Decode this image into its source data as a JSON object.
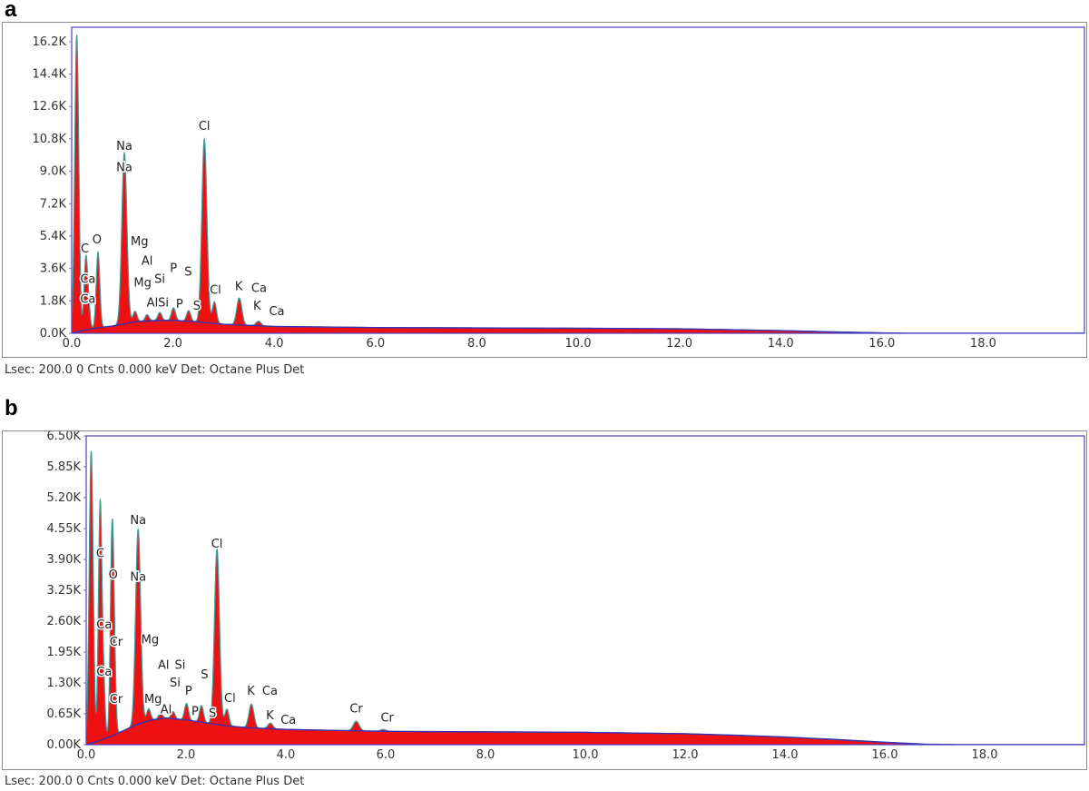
{
  "panels": [
    {
      "letter": "a",
      "status": "Lsec: 200.0 0 Cnts  0.000 keV Det: Octane Plus Det"
    },
    {
      "letter": "b",
      "status": "Lsec: 200.0 0 Cnts  0.000 keV Det: Octane Plus Det"
    }
  ],
  "chart_data": [
    {
      "type": "area",
      "panel": "a",
      "title": "",
      "xlabel": "",
      "ylabel": "",
      "xlim": [
        0.0,
        20.0
      ],
      "ylim": [
        0,
        17000
      ],
      "x_ticks": [
        0.0,
        2.0,
        4.0,
        6.0,
        8.0,
        10.0,
        12.0,
        14.0,
        16.0,
        18.0
      ],
      "x_tick_labels": [
        "0.0",
        "2.0",
        "4.0",
        "6.0",
        "8.0",
        "10.0",
        "12.0",
        "14.0",
        "16.0",
        "18.0"
      ],
      "y_ticks": [
        0,
        1800,
        3600,
        5400,
        7200,
        9000,
        10800,
        12600,
        14400,
        16200
      ],
      "y_tick_labels": [
        "0.0K",
        "1.8K",
        "3.6K",
        "5.4K",
        "7.2K",
        "9.0K",
        "10.8K",
        "12.6K",
        "14.4K",
        "16.2K"
      ],
      "background": {
        "x": [
          0.0,
          0.2,
          0.5,
          0.8,
          1.0,
          1.3,
          1.6,
          2.0,
          2.4,
          3.0,
          4.0,
          6.0,
          8.0,
          10.0,
          12.0,
          14.0,
          15.0,
          16.0,
          16.5,
          20.0
        ],
        "y": [
          0,
          150,
          300,
          400,
          500,
          650,
          700,
          720,
          650,
          500,
          380,
          320,
          300,
          280,
          250,
          150,
          80,
          20,
          0,
          0
        ]
      },
      "peaks": [
        {
          "x": 0.1,
          "y": 16500,
          "w": 0.04
        },
        {
          "x": 0.28,
          "y": 4000,
          "w": 0.035
        },
        {
          "x": 0.34,
          "y": 900,
          "w": 0.03
        },
        {
          "x": 0.52,
          "y": 4200,
          "w": 0.035
        },
        {
          "x": 1.04,
          "y": 9500,
          "w": 0.05
        },
        {
          "x": 1.25,
          "y": 600,
          "w": 0.04
        },
        {
          "x": 1.49,
          "y": 350,
          "w": 0.04
        },
        {
          "x": 1.74,
          "y": 450,
          "w": 0.04
        },
        {
          "x": 2.01,
          "y": 700,
          "w": 0.04
        },
        {
          "x": 2.31,
          "y": 600,
          "w": 0.04
        },
        {
          "x": 2.62,
          "y": 10200,
          "w": 0.05
        },
        {
          "x": 2.82,
          "y": 1200,
          "w": 0.04
        },
        {
          "x": 3.31,
          "y": 1500,
          "w": 0.05
        },
        {
          "x": 3.69,
          "y": 250,
          "w": 0.05
        }
      ],
      "labels": [
        {
          "text": "C",
          "x": 0.26,
          "y": 4500
        },
        {
          "text": "O",
          "x": 0.5,
          "y": 5000
        },
        {
          "text": "Ca",
          "x": 0.32,
          "y": 2800
        },
        {
          "text": "Ca",
          "x": 0.32,
          "y": 1700
        },
        {
          "text": "Na",
          "x": 1.04,
          "y": 10200
        },
        {
          "text": "Na",
          "x": 1.04,
          "y": 9000
        },
        {
          "text": "Mg",
          "x": 1.34,
          "y": 4900
        },
        {
          "text": "Al",
          "x": 1.49,
          "y": 3800
        },
        {
          "text": "Si",
          "x": 1.74,
          "y": 2800
        },
        {
          "text": "P",
          "x": 2.01,
          "y": 3400
        },
        {
          "text": "S",
          "x": 2.3,
          "y": 3200
        },
        {
          "text": "Mg",
          "x": 1.4,
          "y": 2600
        },
        {
          "text": "AlSi",
          "x": 1.7,
          "y": 1500
        },
        {
          "text": "P",
          "x": 2.13,
          "y": 1400
        },
        {
          "text": "S",
          "x": 2.47,
          "y": 1300
        },
        {
          "text": "Cl",
          "x": 2.62,
          "y": 11300
        },
        {
          "text": "Cl",
          "x": 2.84,
          "y": 2200
        },
        {
          "text": "K",
          "x": 3.3,
          "y": 2400
        },
        {
          "text": "Ca",
          "x": 3.7,
          "y": 2300
        },
        {
          "text": "K",
          "x": 3.66,
          "y": 1300
        },
        {
          "text": "Ca",
          "x": 4.05,
          "y": 1000
        }
      ]
    },
    {
      "type": "area",
      "panel": "b",
      "title": "",
      "xlabel": "",
      "ylabel": "",
      "xlim": [
        0.0,
        20.0
      ],
      "ylim": [
        0,
        6500
      ],
      "x_ticks": [
        0.0,
        2.0,
        4.0,
        6.0,
        8.0,
        10.0,
        12.0,
        14.0,
        16.0,
        18.0
      ],
      "x_tick_labels": [
        "0.0",
        "2.0",
        "4.0",
        "6.0",
        "8.0",
        "10.0",
        "12.0",
        "14.0",
        "16.0",
        "18.0"
      ],
      "y_ticks": [
        0,
        650,
        1300,
        1950,
        2600,
        3250,
        3900,
        4550,
        5200,
        5850,
        6500
      ],
      "y_tick_labels": [
        "0.00K",
        "0.65K",
        "1.30K",
        "1.95K",
        "2.60K",
        "3.25K",
        "3.90K",
        "4.55K",
        "5.20K",
        "5.85K",
        "6.50K"
      ],
      "background": {
        "x": [
          0.0,
          0.2,
          0.5,
          0.8,
          1.0,
          1.3,
          1.6,
          2.0,
          2.4,
          2.8,
          3.2,
          4.0,
          6.0,
          8.0,
          10.0,
          12.0,
          13.0,
          14.0,
          15.0,
          16.0,
          16.8,
          17.5,
          20.0
        ],
        "y": [
          0,
          60,
          180,
          320,
          420,
          520,
          560,
          520,
          460,
          400,
          360,
          320,
          280,
          270,
          260,
          230,
          200,
          160,
          110,
          50,
          10,
          0,
          0
        ]
      },
      "peaks": [
        {
          "x": 0.1,
          "y": 6150,
          "w": 0.04
        },
        {
          "x": 0.28,
          "y": 5000,
          "w": 0.035
        },
        {
          "x": 0.35,
          "y": 1000,
          "w": 0.03
        },
        {
          "x": 0.52,
          "y": 4350,
          "w": 0.035
        },
        {
          "x": 0.57,
          "y": 800,
          "w": 0.03
        },
        {
          "x": 1.04,
          "y": 4100,
          "w": 0.05
        },
        {
          "x": 1.25,
          "y": 250,
          "w": 0.04
        },
        {
          "x": 1.49,
          "y": 120,
          "w": 0.04
        },
        {
          "x": 1.74,
          "y": 150,
          "w": 0.04
        },
        {
          "x": 2.01,
          "y": 350,
          "w": 0.04
        },
        {
          "x": 2.31,
          "y": 350,
          "w": 0.04
        },
        {
          "x": 2.62,
          "y": 3700,
          "w": 0.05
        },
        {
          "x": 2.82,
          "y": 350,
          "w": 0.04
        },
        {
          "x": 3.31,
          "y": 500,
          "w": 0.05
        },
        {
          "x": 3.69,
          "y": 120,
          "w": 0.05
        },
        {
          "x": 5.41,
          "y": 200,
          "w": 0.06
        },
        {
          "x": 5.95,
          "y": 40,
          "w": 0.06
        }
      ],
      "labels": [
        {
          "text": "C",
          "x": 0.28,
          "y": 3950
        },
        {
          "text": "O",
          "x": 0.54,
          "y": 3500
        },
        {
          "text": "Ca",
          "x": 0.36,
          "y": 2450
        },
        {
          "text": "Cr",
          "x": 0.6,
          "y": 2080
        },
        {
          "text": "Ca",
          "x": 0.36,
          "y": 1450
        },
        {
          "text": "Cr",
          "x": 0.6,
          "y": 880
        },
        {
          "text": "Na",
          "x": 1.04,
          "y": 4650
        },
        {
          "text": "Na",
          "x": 1.04,
          "y": 3450
        },
        {
          "text": "Mg",
          "x": 1.28,
          "y": 2130
        },
        {
          "text": "Al",
          "x": 1.55,
          "y": 1600
        },
        {
          "text": "Si",
          "x": 1.88,
          "y": 1600
        },
        {
          "text": "Si",
          "x": 1.78,
          "y": 1220
        },
        {
          "text": "P",
          "x": 2.05,
          "y": 1050
        },
        {
          "text": "S",
          "x": 2.37,
          "y": 1400
        },
        {
          "text": "Mg",
          "x": 1.34,
          "y": 880
        },
        {
          "text": "Al",
          "x": 1.6,
          "y": 660
        },
        {
          "text": "P",
          "x": 2.18,
          "y": 620
        },
        {
          "text": "S",
          "x": 2.53,
          "y": 580
        },
        {
          "text": "Cl",
          "x": 2.62,
          "y": 4150
        },
        {
          "text": "Cl",
          "x": 2.88,
          "y": 900
        },
        {
          "text": "K",
          "x": 3.3,
          "y": 1050
        },
        {
          "text": "Ca",
          "x": 3.68,
          "y": 1050
        },
        {
          "text": "K",
          "x": 3.68,
          "y": 540
        },
        {
          "text": "Ca",
          "x": 4.05,
          "y": 440
        },
        {
          "text": "Cr",
          "x": 5.41,
          "y": 680
        },
        {
          "text": "Cr",
          "x": 6.03,
          "y": 490
        }
      ]
    }
  ],
  "colors": {
    "fill": "#ee1111",
    "trace": "#3f9a9c",
    "background_line": "#3b30b0",
    "plot_border": "#4a3fc2",
    "label_shadow": "#ffffff"
  }
}
